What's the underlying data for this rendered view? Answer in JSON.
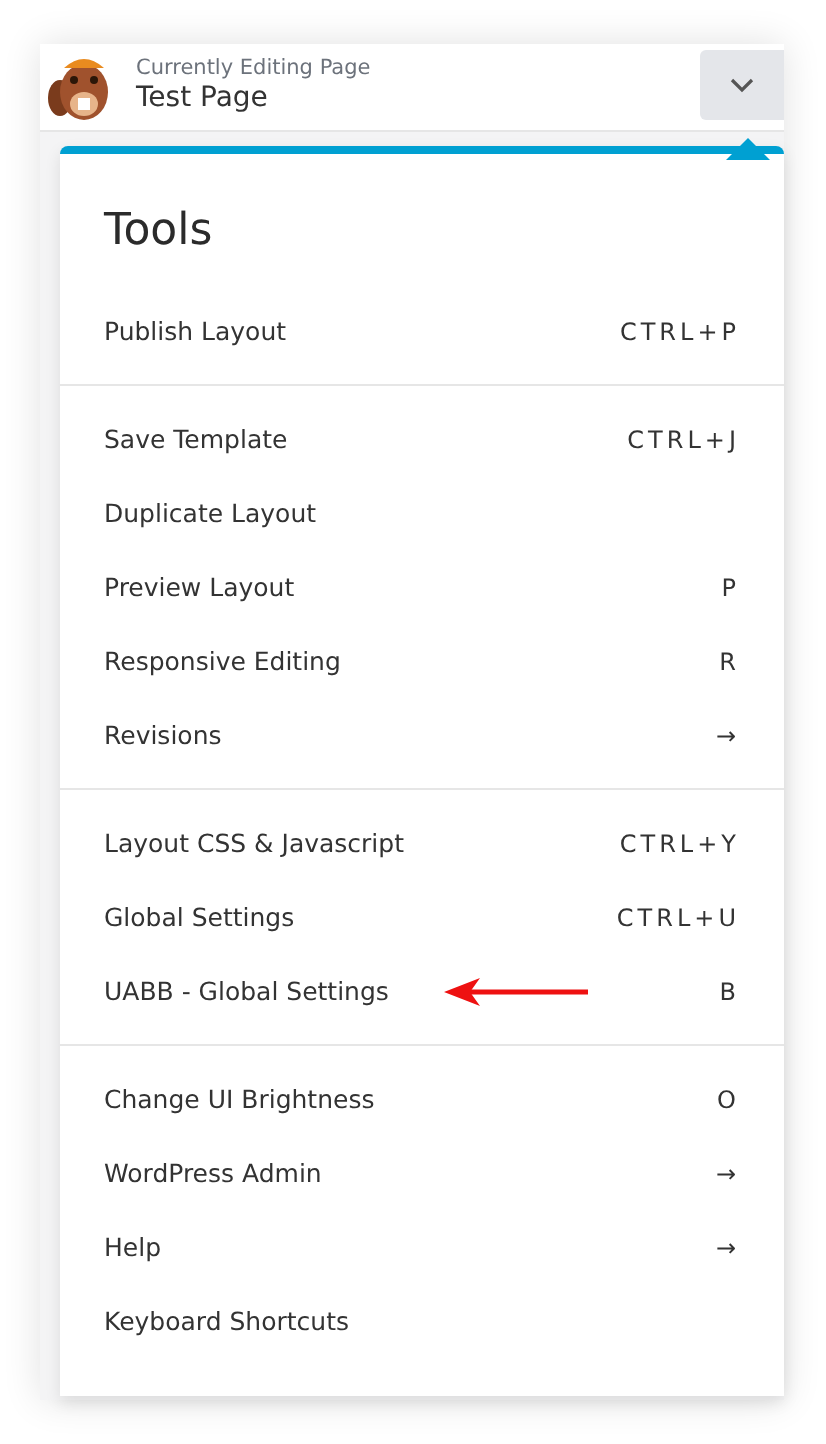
{
  "header": {
    "label": "Currently Editing Page",
    "page_title": "Test Page"
  },
  "menu": {
    "title": "Tools",
    "groups": [
      {
        "items": [
          {
            "label": "Publish Layout",
            "shortcut": "CTRL+P"
          }
        ]
      },
      {
        "items": [
          {
            "label": "Save Template",
            "shortcut": "CTRL+J"
          },
          {
            "label": "Duplicate Layout"
          },
          {
            "label": "Preview Layout",
            "shortcut": "P"
          },
          {
            "label": "Responsive Editing",
            "shortcut": "R"
          },
          {
            "label": "Revisions",
            "shortcut": "→"
          }
        ]
      },
      {
        "items": [
          {
            "label": "Layout CSS & Javascript",
            "shortcut": "CTRL+Y"
          },
          {
            "label": "Global Settings",
            "shortcut": "CTRL+U"
          },
          {
            "label": "UABB - Global Settings",
            "shortcut": "B",
            "annotated": true
          }
        ]
      },
      {
        "items": [
          {
            "label": "Change UI Brightness",
            "shortcut": "O"
          },
          {
            "label": "WordPress Admin",
            "shortcut": "→"
          },
          {
            "label": "Help",
            "shortcut": "→"
          },
          {
            "label": "Keyboard Shortcuts"
          }
        ]
      }
    ]
  }
}
